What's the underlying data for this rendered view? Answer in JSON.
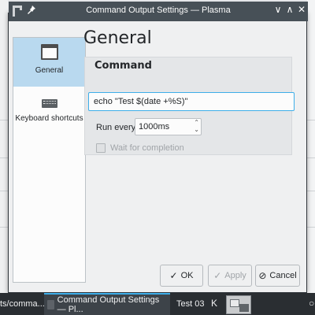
{
  "window": {
    "title": "Command Output Settings — Plasma",
    "controls": [
      "∨",
      "∧",
      "✕"
    ]
  },
  "sidebar": {
    "items": [
      {
        "label": "General",
        "icon": "window-icon",
        "active": true
      },
      {
        "label": "Keyboard shortcuts",
        "icon": "keyboard-icon",
        "active": false
      }
    ]
  },
  "main": {
    "page_title": "General",
    "group_title": "Command",
    "command_value": "echo \"Test $(date +%S)\"",
    "run_every_label": "Run every",
    "run_every_value": "1000ms",
    "wait_label": "Wait for completion",
    "wait_checked": false
  },
  "buttons": {
    "ok": "OK",
    "apply": "Apply",
    "cancel": "Cancel"
  },
  "taskbar": {
    "item_left": "ts/comma...",
    "item_active": "Command Output Settings — Pl...",
    "item_test": "Test 03"
  },
  "colors": {
    "accent": "#3daee9",
    "titlebar": "#475057",
    "selected": "#b9d9ef",
    "taskbar": "#2a2e32"
  }
}
